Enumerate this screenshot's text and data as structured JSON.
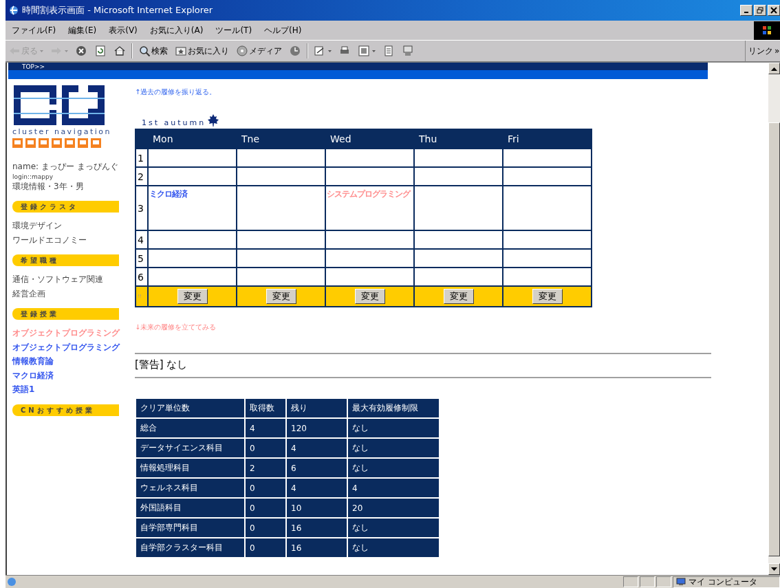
{
  "window": {
    "title": "時間割表示画面 - Microsoft Internet Explorer"
  },
  "menu": [
    "ファイル(F)",
    "編集(E)",
    "表示(V)",
    "お気に入り(A)",
    "ツール(T)",
    "ヘルプ(H)"
  ],
  "toolbar": [
    {
      "kind": "back",
      "label": "戻る",
      "disabled": true,
      "menu_caret": true
    },
    {
      "kind": "forward",
      "disabled": true,
      "menu_caret": true
    },
    {
      "kind": "stop",
      "disabled": false,
      "menu_caret": false
    },
    {
      "kind": "refresh",
      "disabled": false,
      "menu_caret": false
    },
    {
      "kind": "home",
      "disabled": false,
      "menu_caret": false
    },
    {
      "kind": "search",
      "label": "検索",
      "disabled": false,
      "menu_caret": false
    },
    {
      "kind": "favorites",
      "label": "お気に入り",
      "disabled": false,
      "menu_caret": false
    },
    {
      "kind": "media",
      "label": "メディア",
      "disabled": false,
      "menu_caret": false
    },
    {
      "kind": "history",
      "disabled": false,
      "menu_caret": false
    },
    {
      "kind": "mail",
      "disabled": false,
      "menu_caret": true
    },
    {
      "kind": "print",
      "disabled": false,
      "menu_caret": false
    },
    {
      "kind": "edit",
      "disabled": false,
      "menu_caret": true
    },
    {
      "kind": "discuss",
      "disabled": false,
      "menu_caret": false
    },
    {
      "kind": "messenger",
      "disabled": false,
      "menu_caret": false
    }
  ],
  "links_label": "リンク",
  "links_chevron": "»",
  "page": {
    "top_link": "TOP>>",
    "sidebar": {
      "logo_caption": "cluster navigation",
      "profile": [
        "name: まっぴー まっぴんぐ",
        "login::mappy",
        "環境情報・3年・男"
      ],
      "sections": [
        {
          "heading": "登録クラスタ",
          "items": [
            {
              "label": "環境デザイン"
            },
            {
              "label": "ワールドエコノミー"
            }
          ]
        },
        {
          "heading": "希望職種",
          "items": [
            {
              "label": "通信・ソフトウェア関連"
            },
            {
              "label": "経営企画"
            }
          ]
        },
        {
          "heading": "登録授業",
          "items": [
            {
              "label": "オブジェクトプログラミング",
              "color": "#ff8c8c"
            },
            {
              "label": "オブジェクトプログラミング",
              "color": "#3355ee"
            },
            {
              "label": "情報教育論",
              "color": "#3355ee"
            },
            {
              "label": "マクロ経済",
              "color": "#3355ee"
            },
            {
              "label": "英語1",
              "color": "#3355ee"
            }
          ]
        },
        {
          "heading": "CNおすすめ授業"
        }
      ]
    },
    "past_link": "↑過去の履修を振り返る。",
    "timetable": {
      "term": "1st autumn",
      "days": [
        "Mon",
        "Tne",
        "Wed",
        "Thu",
        "Fri"
      ],
      "periods": [
        {
          "number": "1",
          "cells": [
            null,
            null,
            null,
            null,
            null
          ]
        },
        {
          "number": "2",
          "cells": [
            null,
            null,
            null,
            null,
            null
          ]
        },
        {
          "number": "3",
          "cells": [
            {
              "name": "ミクロ経済",
              "color": "#3355ee"
            },
            null,
            {
              "name": "システムプログラミング",
              "color": "#ff8c8c"
            },
            null,
            null
          ]
        },
        {
          "number": "4",
          "cells": [
            null,
            null,
            null,
            null,
            null
          ]
        },
        {
          "number": "5",
          "cells": [
            null,
            null,
            null,
            null,
            null
          ]
        },
        {
          "number": "6",
          "cells": [
            null,
            null,
            null,
            null,
            null
          ]
        }
      ],
      "footer_mark": "!!",
      "change_buttons": [
        "変更",
        "変更",
        "変更",
        "変更",
        "変更"
      ]
    },
    "future_link": "↓未来の履修を立ててみる",
    "warning": "[警告] なし",
    "credits": {
      "columns": [
        "クリア単位数",
        "取得数",
        "残り",
        "最大有効履修制限"
      ],
      "rows": [
        [
          "総合",
          "4",
          "120",
          "なし"
        ],
        [
          "データサイエンス科目",
          "0",
          "4",
          "なし"
        ],
        [
          "情報処理科目",
          "2",
          "6",
          "なし"
        ],
        [
          "ウェルネス科目",
          "0",
          "4",
          "4"
        ],
        [
          "外国語科目",
          "0",
          "10",
          "20"
        ],
        [
          "自学部専門科目",
          "0",
          "16",
          "なし"
        ],
        [
          "自学部クラスター科目",
          "0",
          "16",
          "なし"
        ]
      ]
    }
  },
  "status_text": "マイ コンピュータ"
}
